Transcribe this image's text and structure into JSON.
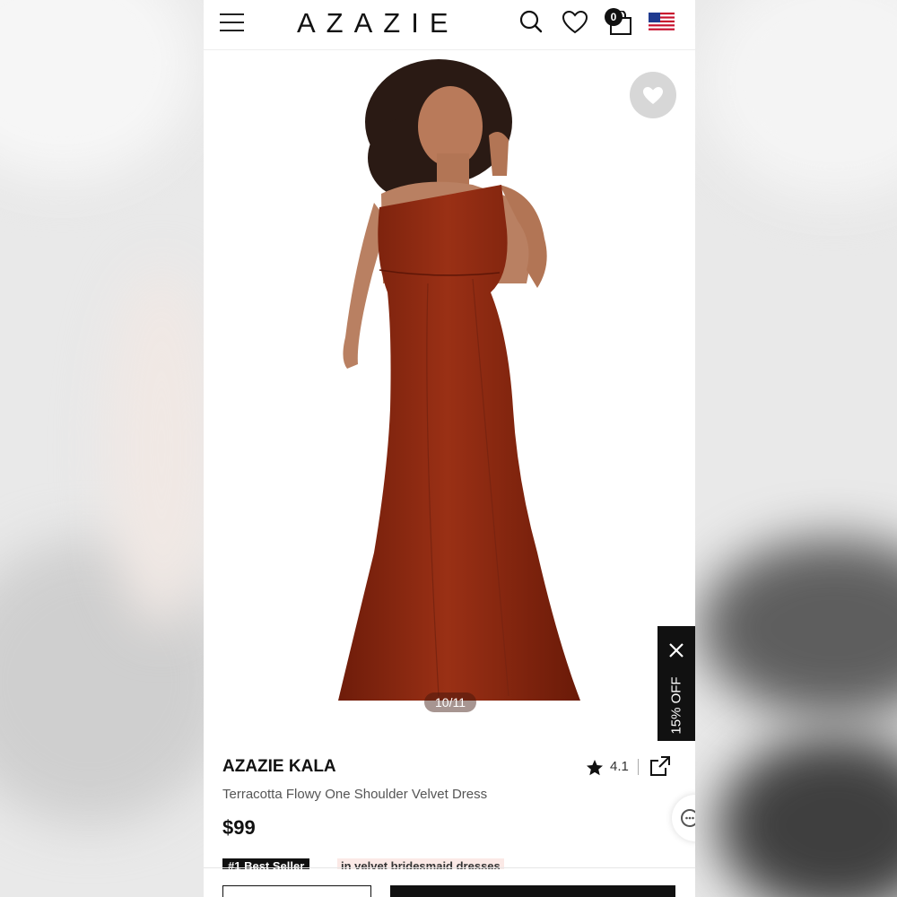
{
  "header": {
    "brand": "AZAZIE",
    "cart_count": "0"
  },
  "gallery": {
    "counter": "10/11"
  },
  "promo": {
    "label": "15% OFF"
  },
  "product": {
    "name": "AZAZIE KALA",
    "subtitle": "Terracotta Flowy One Shoulder Velvet Dress",
    "price": "$99",
    "rating": "4.1",
    "bestseller_badge": "#1 Best Seller",
    "bestseller_text": "in velvet bridesmaid dresses"
  },
  "colors": {
    "dress": "#8e2a12",
    "accent": "#111111"
  },
  "icons": [
    "menu-icon",
    "search-icon",
    "heart-icon",
    "cart-icon",
    "us-flag-icon",
    "close-icon",
    "star-icon",
    "share-icon",
    "chat-icon"
  ]
}
